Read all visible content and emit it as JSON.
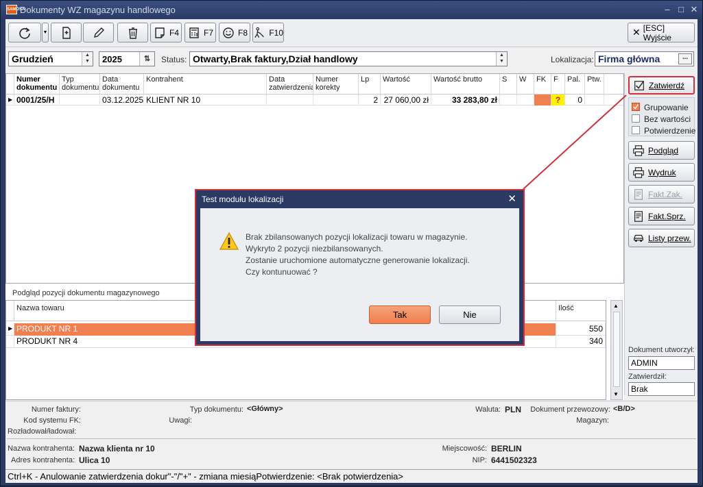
{
  "window": {
    "title": "Dokumenty WZ magazynu handlowego",
    "app_badge": "SAMOSA"
  },
  "toolbar": {
    "f4": "F4",
    "f7": "F7",
    "f8": "F8",
    "f10": "F10",
    "exit_label": "[ESC] Wyjście"
  },
  "filter": {
    "month": "Grudzień",
    "year": "2025",
    "status_label": "Status:",
    "status_value": "Otwarty,Brak faktury,Dział handlowy",
    "location_label": "Lokalizacja:",
    "location_value": "Firma główna"
  },
  "grid": {
    "columns": [
      "Numer dokumentu",
      "Typ dokumentu",
      "Data dokumentu",
      "Kontrahent",
      "Data zatwierdzenia",
      "Numer korekty",
      "Lp",
      "Wartość",
      "Wartość brutto",
      "S",
      "W",
      "FK",
      "F",
      "Pal.",
      "Ptw."
    ],
    "rows": [
      {
        "numer": "0001/25/H",
        "typ": "",
        "data": "03.12.2025",
        "kontrahent": "KLIENT NR 10",
        "data_zatw": "",
        "korekta": "",
        "lp": "2",
        "wartosc": "27 060,00 zł",
        "brutto": "33 283,80 zł",
        "s": "",
        "w": "",
        "fk": "",
        "f": "?",
        "pal": "0",
        "ptw": ""
      }
    ]
  },
  "side": {
    "confirm": "Zatwierdź",
    "grouping": "Grupowanie",
    "no_value": "Bez wartości",
    "confirmation": "Potwierdzenie",
    "preview": "Podgląd",
    "print": "Wydruk",
    "fakt_zak": "Fakt.Zak.",
    "fakt_sprz": "Fakt.Sprz.",
    "listy": "Listy przew.",
    "created_by_label": "Dokument utworzył:",
    "created_by": "ADMIN",
    "approved_by_label": "Zatwierdził:",
    "approved_by": "Brak"
  },
  "detail": {
    "caption": "Podgląd pozycji dokumentu magazynowego",
    "columns": [
      "Nazwa towaru",
      "Ilość"
    ],
    "rows": [
      {
        "name": "PRODUKT NR 1",
        "qty": "550"
      },
      {
        "name": "PRODUKT NR 4",
        "qty": "340"
      }
    ]
  },
  "info": {
    "invoice_no_label": "Numer faktury:",
    "fk_code_label": "Kod systemu FK:",
    "unloader_label": "Rozładował/ładował:",
    "doc_type_label": "Typ dokumentu:",
    "doc_type": "<Główny>",
    "notes_label": "Uwagi:",
    "currency_label": "Waluta:",
    "currency": "PLN",
    "carrier_doc_label": "Dokument przewozowy:",
    "carrier_doc": "<B/D>",
    "warehouse_label": "Magazyn:",
    "client_name_label": "Nazwa kontrahenta:",
    "client_name": "Nazwa klienta nr 10",
    "client_address_label": "Adres kontrahenta:",
    "client_address": "Ulica 10",
    "city_label": "Miejscowość:",
    "city": "BERLIN",
    "nip_label": "NIP:",
    "nip": "6441502323"
  },
  "statusbar": {
    "text": "Ctrl+K - Anulowanie zatwierdzenia dokur\"-\"/\"+\" - zmiana miesiąPotwierdzenie: <Brak potwierdzenia>"
  },
  "dialog": {
    "title": "Test modułu lokalizacji",
    "line1": "Brak zbilansowanych pozycji lokalizacji towaru w magazynie.",
    "line2": "Wykryto 2 pozycji niezbilansowanych.",
    "line3": "Zostanie uruchomione automatyczne generowanie lokalizacji.",
    "line4": "Czy kontunuować ?",
    "yes": "Tak",
    "no": "Nie"
  },
  "colors": {
    "accent": "#f08050",
    "dialog_frame": "#2b3a63",
    "highlight": "#d0303a"
  }
}
